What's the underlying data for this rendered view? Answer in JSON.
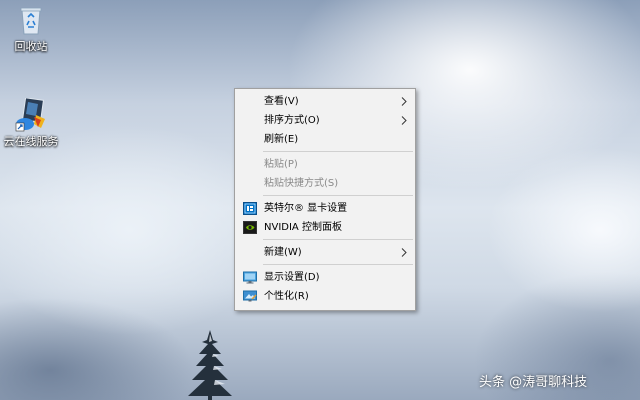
{
  "desktop": {
    "icons": [
      {
        "label": "回收站",
        "icon": "recycle-bin-icon"
      },
      {
        "label": "云在线服务",
        "icon": "cloud-service-icon"
      }
    ]
  },
  "context_menu": {
    "items": [
      {
        "label": "查看(V)",
        "submenu": true,
        "disabled": false
      },
      {
        "label": "排序方式(O)",
        "submenu": true,
        "disabled": false
      },
      {
        "label": "刷新(E)",
        "submenu": false,
        "disabled": false
      },
      {
        "label": "粘贴(P)",
        "submenu": false,
        "disabled": true
      },
      {
        "label": "粘贴快捷方式(S)",
        "submenu": false,
        "disabled": true
      },
      {
        "label": "英特尔® 显卡设置",
        "submenu": false,
        "disabled": false,
        "icon": "intel-graphics-icon"
      },
      {
        "label": "NVIDIA 控制面板",
        "submenu": false,
        "disabled": false,
        "icon": "nvidia-icon"
      },
      {
        "label": "新建(W)",
        "submenu": true,
        "disabled": false
      },
      {
        "label": "显示设置(D)",
        "submenu": false,
        "disabled": false,
        "icon": "display-settings-icon"
      },
      {
        "label": "个性化(R)",
        "submenu": false,
        "disabled": false,
        "icon": "personalize-icon"
      }
    ]
  },
  "watermark": {
    "text": "头条 @涛哥聊科技"
  },
  "colors": {
    "menu_bg": "#f2f2f2",
    "disabled_text": "#8a8a8a",
    "nvidia_green": "#76b900",
    "intel_blue": "#0071c5"
  }
}
